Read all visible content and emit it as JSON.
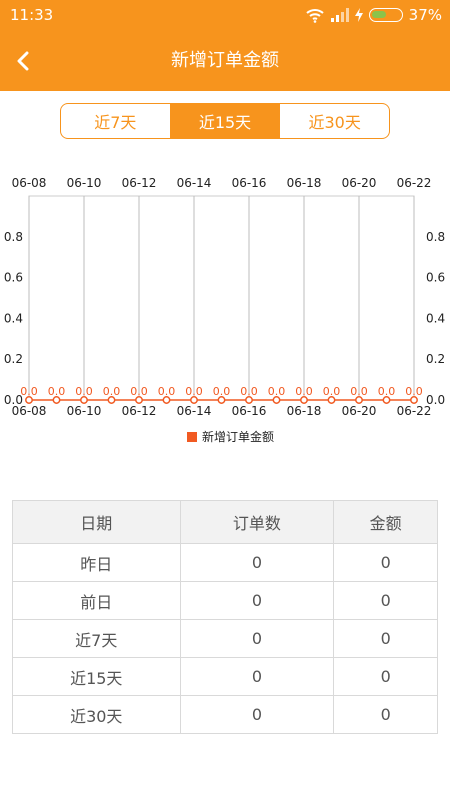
{
  "status": {
    "time": "11:33",
    "battery": "37%"
  },
  "header": {
    "title": "新增订单金额"
  },
  "tabs": [
    {
      "label": "近7天",
      "active": false
    },
    {
      "label": "近15天",
      "active": true
    },
    {
      "label": "近30天",
      "active": false
    }
  ],
  "chart_data": {
    "type": "line",
    "x": [
      "06-08",
      "06-09",
      "06-10",
      "06-11",
      "06-12",
      "06-13",
      "06-14",
      "06-15",
      "06-16",
      "06-17",
      "06-18",
      "06-19",
      "06-20",
      "06-21",
      "06-22"
    ],
    "x_tick_labels": [
      "06-08",
      "06-10",
      "06-12",
      "06-14",
      "06-16",
      "06-18",
      "06-20",
      "06-22"
    ],
    "series": [
      {
        "name": "新增订单金额",
        "values": [
          0,
          0,
          0,
          0,
          0,
          0,
          0,
          0,
          0,
          0,
          0,
          0,
          0,
          0,
          0
        ],
        "color": "#f15a22"
      }
    ],
    "point_labels": [
      "0.0",
      "0.0",
      "0.0",
      "0.0",
      "0.0",
      "0.0",
      "0.0",
      "0.0",
      "0.0",
      "0.0",
      "0.0",
      "0.0",
      "0.0",
      "0.0",
      "0.0"
    ],
    "y_ticks": [
      "0.0",
      "0.2",
      "0.4",
      "0.6",
      "0.8"
    ],
    "ylim": [
      0,
      1
    ]
  },
  "table": {
    "headers": [
      "日期",
      "订单数",
      "金额"
    ],
    "rows": [
      [
        "昨日",
        "0",
        "0"
      ],
      [
        "前日",
        "0",
        "0"
      ],
      [
        "近7天",
        "0",
        "0"
      ],
      [
        "近15天",
        "0",
        "0"
      ],
      [
        "近30天",
        "0",
        "0"
      ]
    ]
  }
}
